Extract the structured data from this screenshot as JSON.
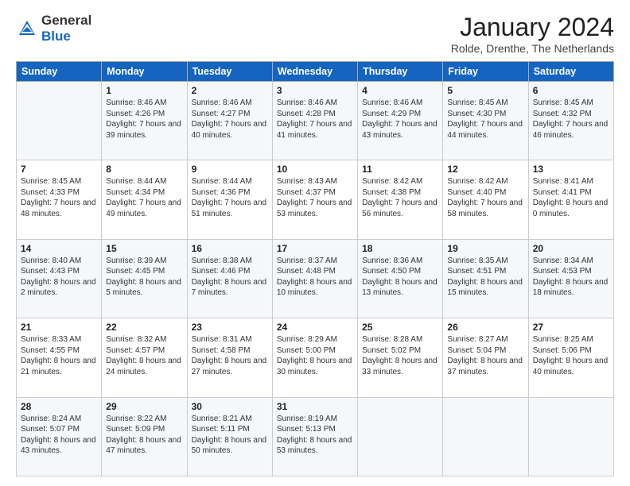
{
  "header": {
    "logo_general": "General",
    "logo_blue": "Blue",
    "month_title": "January 2024",
    "location": "Rolde, Drenthe, The Netherlands"
  },
  "weekdays": [
    "Sunday",
    "Monday",
    "Tuesday",
    "Wednesday",
    "Thursday",
    "Friday",
    "Saturday"
  ],
  "weeks": [
    [
      {
        "day": "",
        "sunrise": "",
        "sunset": "",
        "daylight": ""
      },
      {
        "day": "1",
        "sunrise": "Sunrise: 8:46 AM",
        "sunset": "Sunset: 4:26 PM",
        "daylight": "Daylight: 7 hours and 39 minutes."
      },
      {
        "day": "2",
        "sunrise": "Sunrise: 8:46 AM",
        "sunset": "Sunset: 4:27 PM",
        "daylight": "Daylight: 7 hours and 40 minutes."
      },
      {
        "day": "3",
        "sunrise": "Sunrise: 8:46 AM",
        "sunset": "Sunset: 4:28 PM",
        "daylight": "Daylight: 7 hours and 41 minutes."
      },
      {
        "day": "4",
        "sunrise": "Sunrise: 8:46 AM",
        "sunset": "Sunset: 4:29 PM",
        "daylight": "Daylight: 7 hours and 43 minutes."
      },
      {
        "day": "5",
        "sunrise": "Sunrise: 8:45 AM",
        "sunset": "Sunset: 4:30 PM",
        "daylight": "Daylight: 7 hours and 44 minutes."
      },
      {
        "day": "6",
        "sunrise": "Sunrise: 8:45 AM",
        "sunset": "Sunset: 4:32 PM",
        "daylight": "Daylight: 7 hours and 46 minutes."
      }
    ],
    [
      {
        "day": "7",
        "sunrise": "Sunrise: 8:45 AM",
        "sunset": "Sunset: 4:33 PM",
        "daylight": "Daylight: 7 hours and 48 minutes."
      },
      {
        "day": "8",
        "sunrise": "Sunrise: 8:44 AM",
        "sunset": "Sunset: 4:34 PM",
        "daylight": "Daylight: 7 hours and 49 minutes."
      },
      {
        "day": "9",
        "sunrise": "Sunrise: 8:44 AM",
        "sunset": "Sunset: 4:36 PM",
        "daylight": "Daylight: 7 hours and 51 minutes."
      },
      {
        "day": "10",
        "sunrise": "Sunrise: 8:43 AM",
        "sunset": "Sunset: 4:37 PM",
        "daylight": "Daylight: 7 hours and 53 minutes."
      },
      {
        "day": "11",
        "sunrise": "Sunrise: 8:42 AM",
        "sunset": "Sunset: 4:38 PM",
        "daylight": "Daylight: 7 hours and 56 minutes."
      },
      {
        "day": "12",
        "sunrise": "Sunrise: 8:42 AM",
        "sunset": "Sunset: 4:40 PM",
        "daylight": "Daylight: 7 hours and 58 minutes."
      },
      {
        "day": "13",
        "sunrise": "Sunrise: 8:41 AM",
        "sunset": "Sunset: 4:41 PM",
        "daylight": "Daylight: 8 hours and 0 minutes."
      }
    ],
    [
      {
        "day": "14",
        "sunrise": "Sunrise: 8:40 AM",
        "sunset": "Sunset: 4:43 PM",
        "daylight": "Daylight: 8 hours and 2 minutes."
      },
      {
        "day": "15",
        "sunrise": "Sunrise: 8:39 AM",
        "sunset": "Sunset: 4:45 PM",
        "daylight": "Daylight: 8 hours and 5 minutes."
      },
      {
        "day": "16",
        "sunrise": "Sunrise: 8:38 AM",
        "sunset": "Sunset: 4:46 PM",
        "daylight": "Daylight: 8 hours and 7 minutes."
      },
      {
        "day": "17",
        "sunrise": "Sunrise: 8:37 AM",
        "sunset": "Sunset: 4:48 PM",
        "daylight": "Daylight: 8 hours and 10 minutes."
      },
      {
        "day": "18",
        "sunrise": "Sunrise: 8:36 AM",
        "sunset": "Sunset: 4:50 PM",
        "daylight": "Daylight: 8 hours and 13 minutes."
      },
      {
        "day": "19",
        "sunrise": "Sunrise: 8:35 AM",
        "sunset": "Sunset: 4:51 PM",
        "daylight": "Daylight: 8 hours and 15 minutes."
      },
      {
        "day": "20",
        "sunrise": "Sunrise: 8:34 AM",
        "sunset": "Sunset: 4:53 PM",
        "daylight": "Daylight: 8 hours and 18 minutes."
      }
    ],
    [
      {
        "day": "21",
        "sunrise": "Sunrise: 8:33 AM",
        "sunset": "Sunset: 4:55 PM",
        "daylight": "Daylight: 8 hours and 21 minutes."
      },
      {
        "day": "22",
        "sunrise": "Sunrise: 8:32 AM",
        "sunset": "Sunset: 4:57 PM",
        "daylight": "Daylight: 8 hours and 24 minutes."
      },
      {
        "day": "23",
        "sunrise": "Sunrise: 8:31 AM",
        "sunset": "Sunset: 4:58 PM",
        "daylight": "Daylight: 8 hours and 27 minutes."
      },
      {
        "day": "24",
        "sunrise": "Sunrise: 8:29 AM",
        "sunset": "Sunset: 5:00 PM",
        "daylight": "Daylight: 8 hours and 30 minutes."
      },
      {
        "day": "25",
        "sunrise": "Sunrise: 8:28 AM",
        "sunset": "Sunset: 5:02 PM",
        "daylight": "Daylight: 8 hours and 33 minutes."
      },
      {
        "day": "26",
        "sunrise": "Sunrise: 8:27 AM",
        "sunset": "Sunset: 5:04 PM",
        "daylight": "Daylight: 8 hours and 37 minutes."
      },
      {
        "day": "27",
        "sunrise": "Sunrise: 8:25 AM",
        "sunset": "Sunset: 5:06 PM",
        "daylight": "Daylight: 8 hours and 40 minutes."
      }
    ],
    [
      {
        "day": "28",
        "sunrise": "Sunrise: 8:24 AM",
        "sunset": "Sunset: 5:07 PM",
        "daylight": "Daylight: 8 hours and 43 minutes."
      },
      {
        "day": "29",
        "sunrise": "Sunrise: 8:22 AM",
        "sunset": "Sunset: 5:09 PM",
        "daylight": "Daylight: 8 hours and 47 minutes."
      },
      {
        "day": "30",
        "sunrise": "Sunrise: 8:21 AM",
        "sunset": "Sunset: 5:11 PM",
        "daylight": "Daylight: 8 hours and 50 minutes."
      },
      {
        "day": "31",
        "sunrise": "Sunrise: 8:19 AM",
        "sunset": "Sunset: 5:13 PM",
        "daylight": "Daylight: 8 hours and 53 minutes."
      },
      {
        "day": "",
        "sunrise": "",
        "sunset": "",
        "daylight": ""
      },
      {
        "day": "",
        "sunrise": "",
        "sunset": "",
        "daylight": ""
      },
      {
        "day": "",
        "sunrise": "",
        "sunset": "",
        "daylight": ""
      }
    ]
  ]
}
